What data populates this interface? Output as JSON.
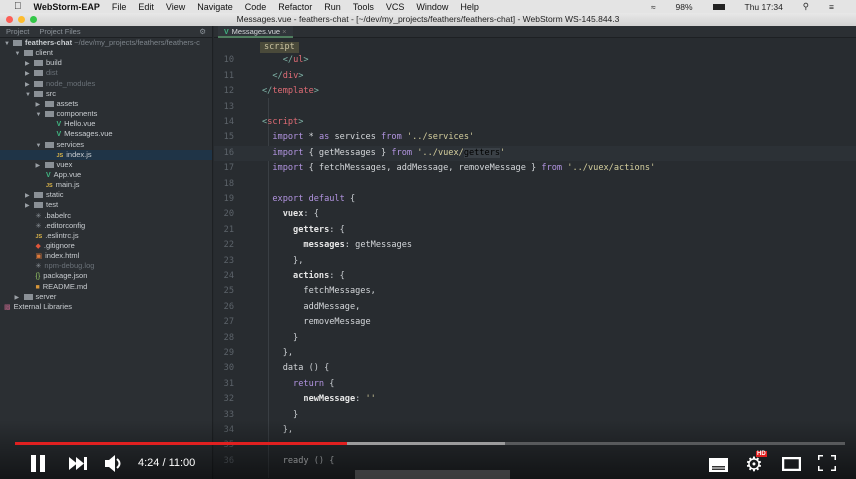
{
  "menubar": {
    "app": "WebStorm-EAP",
    "items": [
      "File",
      "Edit",
      "View",
      "Navigate",
      "Code",
      "Refactor",
      "Run",
      "Tools",
      "VCS",
      "Window",
      "Help"
    ],
    "battery": "98%",
    "clock": "Thu 17:34"
  },
  "window": {
    "title": "Messages.vue - feathers-chat - [~/dev/my_projects/feathers/feathers-chat] - WebStorm WS-145.844.3"
  },
  "sidebar": {
    "tabs": [
      "Project",
      "Project Files"
    ],
    "rows": [
      {
        "label": "feathers-chat",
        "path": " ~/dev/my_projects/feathers/feathers-c",
        "level": 0,
        "type": "folder",
        "open": true
      },
      {
        "label": "client",
        "level": 1,
        "type": "folder",
        "open": true
      },
      {
        "label": "build",
        "level": 2,
        "type": "folder",
        "open": false
      },
      {
        "label": "dist",
        "level": 2,
        "type": "folder",
        "open": false,
        "dim": true
      },
      {
        "label": "node_modules",
        "level": 2,
        "type": "folder",
        "open": false,
        "dim": true
      },
      {
        "label": "src",
        "level": 2,
        "type": "folder",
        "open": true
      },
      {
        "label": "assets",
        "level": 3,
        "type": "folder",
        "open": false
      },
      {
        "label": "components",
        "level": 3,
        "type": "folder",
        "open": true
      },
      {
        "label": "Hello.vue",
        "level": 5,
        "type": "vue"
      },
      {
        "label": "Messages.vue",
        "level": 5,
        "type": "vue"
      },
      {
        "label": "services",
        "level": 3,
        "type": "folder",
        "open": true
      },
      {
        "label": "index.js",
        "level": 5,
        "type": "js",
        "selected": true
      },
      {
        "label": "vuex",
        "level": 3,
        "type": "folder",
        "open": false
      },
      {
        "label": "App.vue",
        "level": 4,
        "type": "vue"
      },
      {
        "label": "main.js",
        "level": 4,
        "type": "js"
      },
      {
        "label": "static",
        "level": 2,
        "type": "folder",
        "open": false
      },
      {
        "label": "test",
        "level": 2,
        "type": "folder",
        "open": false
      },
      {
        "label": ".babelrc",
        "level": 3,
        "type": "cfg"
      },
      {
        "label": ".editorconfig",
        "level": 3,
        "type": "cfg"
      },
      {
        "label": ".eslintrc.js",
        "level": 3,
        "type": "js"
      },
      {
        "label": ".gitignore",
        "level": 3,
        "type": "git"
      },
      {
        "label": "index.html",
        "level": 3,
        "type": "html"
      },
      {
        "label": "npm-debug.log",
        "level": 3,
        "type": "cfg",
        "dim": true
      },
      {
        "label": "package.json",
        "level": 3,
        "type": "json"
      },
      {
        "label": "README.md",
        "level": 3,
        "type": "md"
      },
      {
        "label": "server",
        "level": 1,
        "type": "folder",
        "open": false
      },
      {
        "label": "External Libraries",
        "level": 0,
        "type": "lib"
      }
    ]
  },
  "editor": {
    "tab": "Messages.vue",
    "breadcrumb": "script",
    "lines": [
      {
        "n": "10",
        "t": [
          [
            "    ",
            "pu"
          ],
          [
            "</",
            "br"
          ],
          [
            "ul",
            "tag"
          ],
          [
            ">",
            "br"
          ]
        ]
      },
      {
        "n": "11",
        "t": [
          [
            "  ",
            "pu"
          ],
          [
            "</",
            "br"
          ],
          [
            "div",
            "tag"
          ],
          [
            ">",
            "br"
          ]
        ]
      },
      {
        "n": "12",
        "t": [
          [
            "</",
            "br"
          ],
          [
            "template",
            "tag"
          ],
          [
            ">",
            "br"
          ]
        ]
      },
      {
        "n": "13",
        "t": []
      },
      {
        "n": "14",
        "t": [
          [
            "<",
            "br"
          ],
          [
            "script",
            "tag"
          ],
          [
            ">",
            "br"
          ]
        ]
      },
      {
        "n": "15",
        "t": [
          [
            "  import",
            "kw"
          ],
          [
            " * ",
            "id"
          ],
          [
            "as",
            "kw"
          ],
          [
            " services ",
            "id"
          ],
          [
            "from",
            "kw"
          ],
          [
            " '../services'",
            "str"
          ]
        ]
      },
      {
        "n": "16",
        "t": [
          [
            "  import",
            "kw"
          ],
          [
            " { getMessages } ",
            "id"
          ],
          [
            "from",
            "kw"
          ],
          [
            " '../vuex/",
            "str"
          ],
          [
            "getters",
            "hl"
          ],
          [
            "'",
            "str"
          ]
        ],
        "cur": true
      },
      {
        "n": "17",
        "t": [
          [
            "  import",
            "kw"
          ],
          [
            " { fetchMessages, addMessage, removeMessage } ",
            "id"
          ],
          [
            "from",
            "kw"
          ],
          [
            " '../vuex/actions'",
            "str"
          ]
        ]
      },
      {
        "n": "18",
        "t": []
      },
      {
        "n": "19",
        "t": [
          [
            "  export default",
            "kw"
          ],
          [
            " {",
            "pu"
          ]
        ]
      },
      {
        "n": "20",
        "t": [
          [
            "    vuex",
            "prop"
          ],
          [
            ": {",
            "pu"
          ]
        ]
      },
      {
        "n": "21",
        "t": [
          [
            "      getters",
            "prop"
          ],
          [
            ": {",
            "pu"
          ]
        ]
      },
      {
        "n": "22",
        "t": [
          [
            "        messages",
            "prop"
          ],
          [
            ": getMessages",
            "id"
          ]
        ]
      },
      {
        "n": "23",
        "t": [
          [
            "      },",
            "pu"
          ]
        ]
      },
      {
        "n": "24",
        "t": [
          [
            "      actions",
            "prop"
          ],
          [
            ": {",
            "pu"
          ]
        ]
      },
      {
        "n": "25",
        "t": [
          [
            "        fetchMessages,",
            "id"
          ]
        ]
      },
      {
        "n": "26",
        "t": [
          [
            "        addMessage,",
            "id"
          ]
        ]
      },
      {
        "n": "27",
        "t": [
          [
            "        removeMessage",
            "id"
          ]
        ]
      },
      {
        "n": "28",
        "t": [
          [
            "      }",
            "pu"
          ]
        ]
      },
      {
        "n": "29",
        "t": [
          [
            "    },",
            "pu"
          ]
        ]
      },
      {
        "n": "30",
        "t": [
          [
            "    data",
            "id"
          ],
          [
            " () {",
            "pu"
          ]
        ]
      },
      {
        "n": "31",
        "t": [
          [
            "      return",
            "kw"
          ],
          [
            " {",
            "pu"
          ]
        ]
      },
      {
        "n": "32",
        "t": [
          [
            "        newMessage",
            "prop"
          ],
          [
            ": ",
            "pu"
          ],
          [
            "''",
            "str"
          ]
        ]
      },
      {
        "n": "33",
        "t": [
          [
            "      }",
            "pu"
          ]
        ]
      },
      {
        "n": "34",
        "t": [
          [
            "    },",
            "pu"
          ]
        ]
      },
      {
        "n": "35",
        "t": []
      },
      {
        "n": "36",
        "t": [
          [
            "    ready",
            "id"
          ],
          [
            " () {",
            "pu"
          ]
        ]
      }
    ]
  },
  "player": {
    "time": "4:24 / 11:00",
    "progress": 0.4,
    "buffered": 0.59,
    "hd_badge": "HD"
  }
}
